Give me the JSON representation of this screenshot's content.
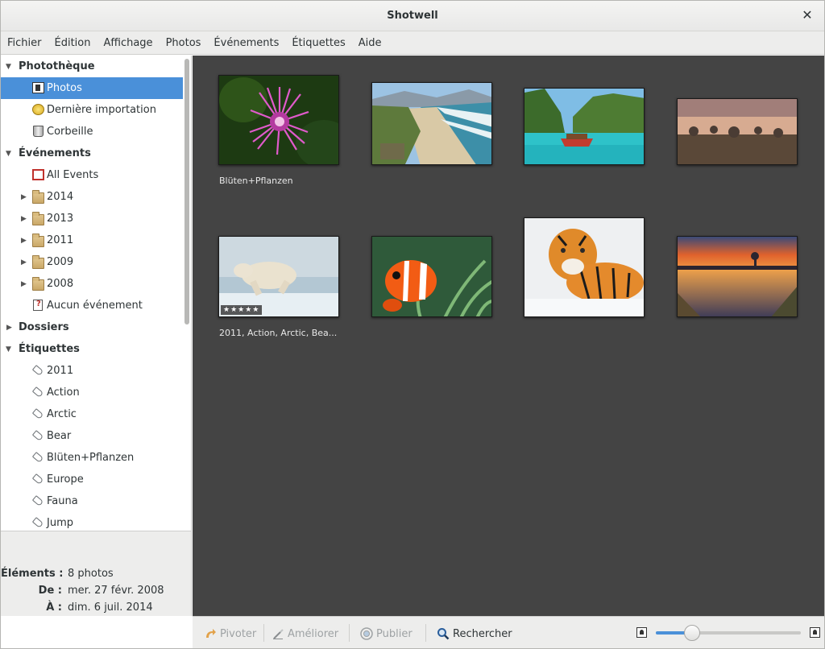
{
  "window": {
    "title": "Shotwell"
  },
  "menu": [
    "Fichier",
    "Édition",
    "Affichage",
    "Photos",
    "Événements",
    "Étiquettes",
    "Aide"
  ],
  "sidebar": {
    "library_header": "Photothèque",
    "library_items": [
      {
        "label": "Photos",
        "icon": "photos-icon",
        "selected": true
      },
      {
        "label": "Dernière importation",
        "icon": "last-import-icon"
      },
      {
        "label": "Corbeille",
        "icon": "trash-icon"
      }
    ],
    "events_header": "Événements",
    "all_events": "All Events",
    "years": [
      "2014",
      "2013",
      "2011",
      "2009",
      "2008"
    ],
    "no_event": "Aucun événement",
    "folders_header": "Dossiers",
    "tags_header": "Étiquettes",
    "tags": [
      "2011",
      "Action",
      "Arctic",
      "Bear",
      "Blüten+Pflanzen",
      "Europe",
      "Fauna",
      "Jump"
    ]
  },
  "info": {
    "items_key": "Éléments :",
    "items_val": "8 photos",
    "from_key": "De :",
    "from_val": "mer. 27 févr. 2008",
    "to_key": "À :",
    "to_val": "dim. 6 juil. 2014"
  },
  "photos": [
    {
      "subject": "pink thistle flower",
      "caption": "Blüten+Pflanzen"
    },
    {
      "subject": "coastal beach",
      "caption": ""
    },
    {
      "subject": "tropical boat lagoon",
      "caption": ""
    },
    {
      "subject": "misty field",
      "caption": ""
    },
    {
      "subject": "polar bear jumping",
      "caption": "2011, Action, Arctic, Bea...",
      "rating": 5
    },
    {
      "subject": "clownfish anemone",
      "caption": ""
    },
    {
      "subject": "tiger in snow",
      "caption": ""
    },
    {
      "subject": "sunset lake",
      "caption": ""
    }
  ],
  "toolbar": {
    "rotate": "Pivoter",
    "enhance": "Améliorer",
    "publish": "Publier",
    "search": "Rechercher",
    "zoom_level": 0.25
  },
  "colors": {
    "selection": "#4a90d9",
    "viewer_bg": "#444444"
  }
}
